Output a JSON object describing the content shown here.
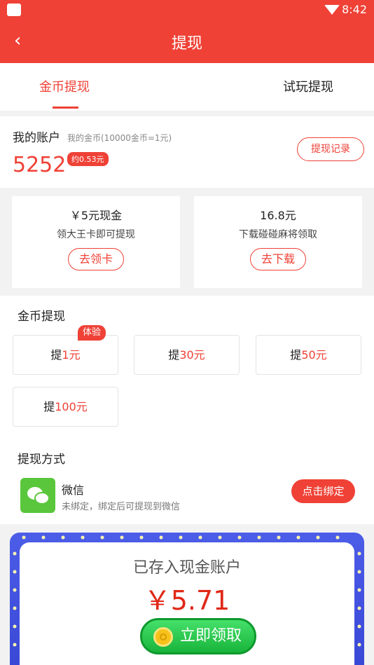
{
  "status_bar": {
    "time": "8:42"
  },
  "app_bar": {
    "title": "提现"
  },
  "tabs": [
    {
      "label": "金币提现"
    },
    {
      "label": "试玩提现"
    }
  ],
  "account": {
    "title": "我的账户",
    "subtitle": "我的金币(10000金币=1元)",
    "coins": "5252",
    "approx": "约0.53元",
    "record_button": "提现记录"
  },
  "promos": [
    {
      "title": "￥5元现金",
      "desc": "领大王卡即可提现",
      "button": "去领卡"
    },
    {
      "title": "16.8元",
      "desc": "下载碰碰麻将领取",
      "button": "去下载"
    }
  ],
  "coin_withdraw": {
    "title": "金币提现",
    "badge": "体验",
    "options": [
      {
        "prefix": "提",
        "amount": "1元"
      },
      {
        "prefix": "提",
        "amount": "30元"
      },
      {
        "prefix": "提",
        "amount": "50元"
      },
      {
        "prefix": "提",
        "amount": "100元"
      }
    ]
  },
  "method": {
    "title": "提现方式",
    "name": "微信",
    "desc": "未绑定，绑定后可提现到微信",
    "bind_button": "点击绑定"
  },
  "reward": {
    "caption": "已存入现金账户",
    "amount": "￥5.71",
    "button": "立即领取"
  }
}
